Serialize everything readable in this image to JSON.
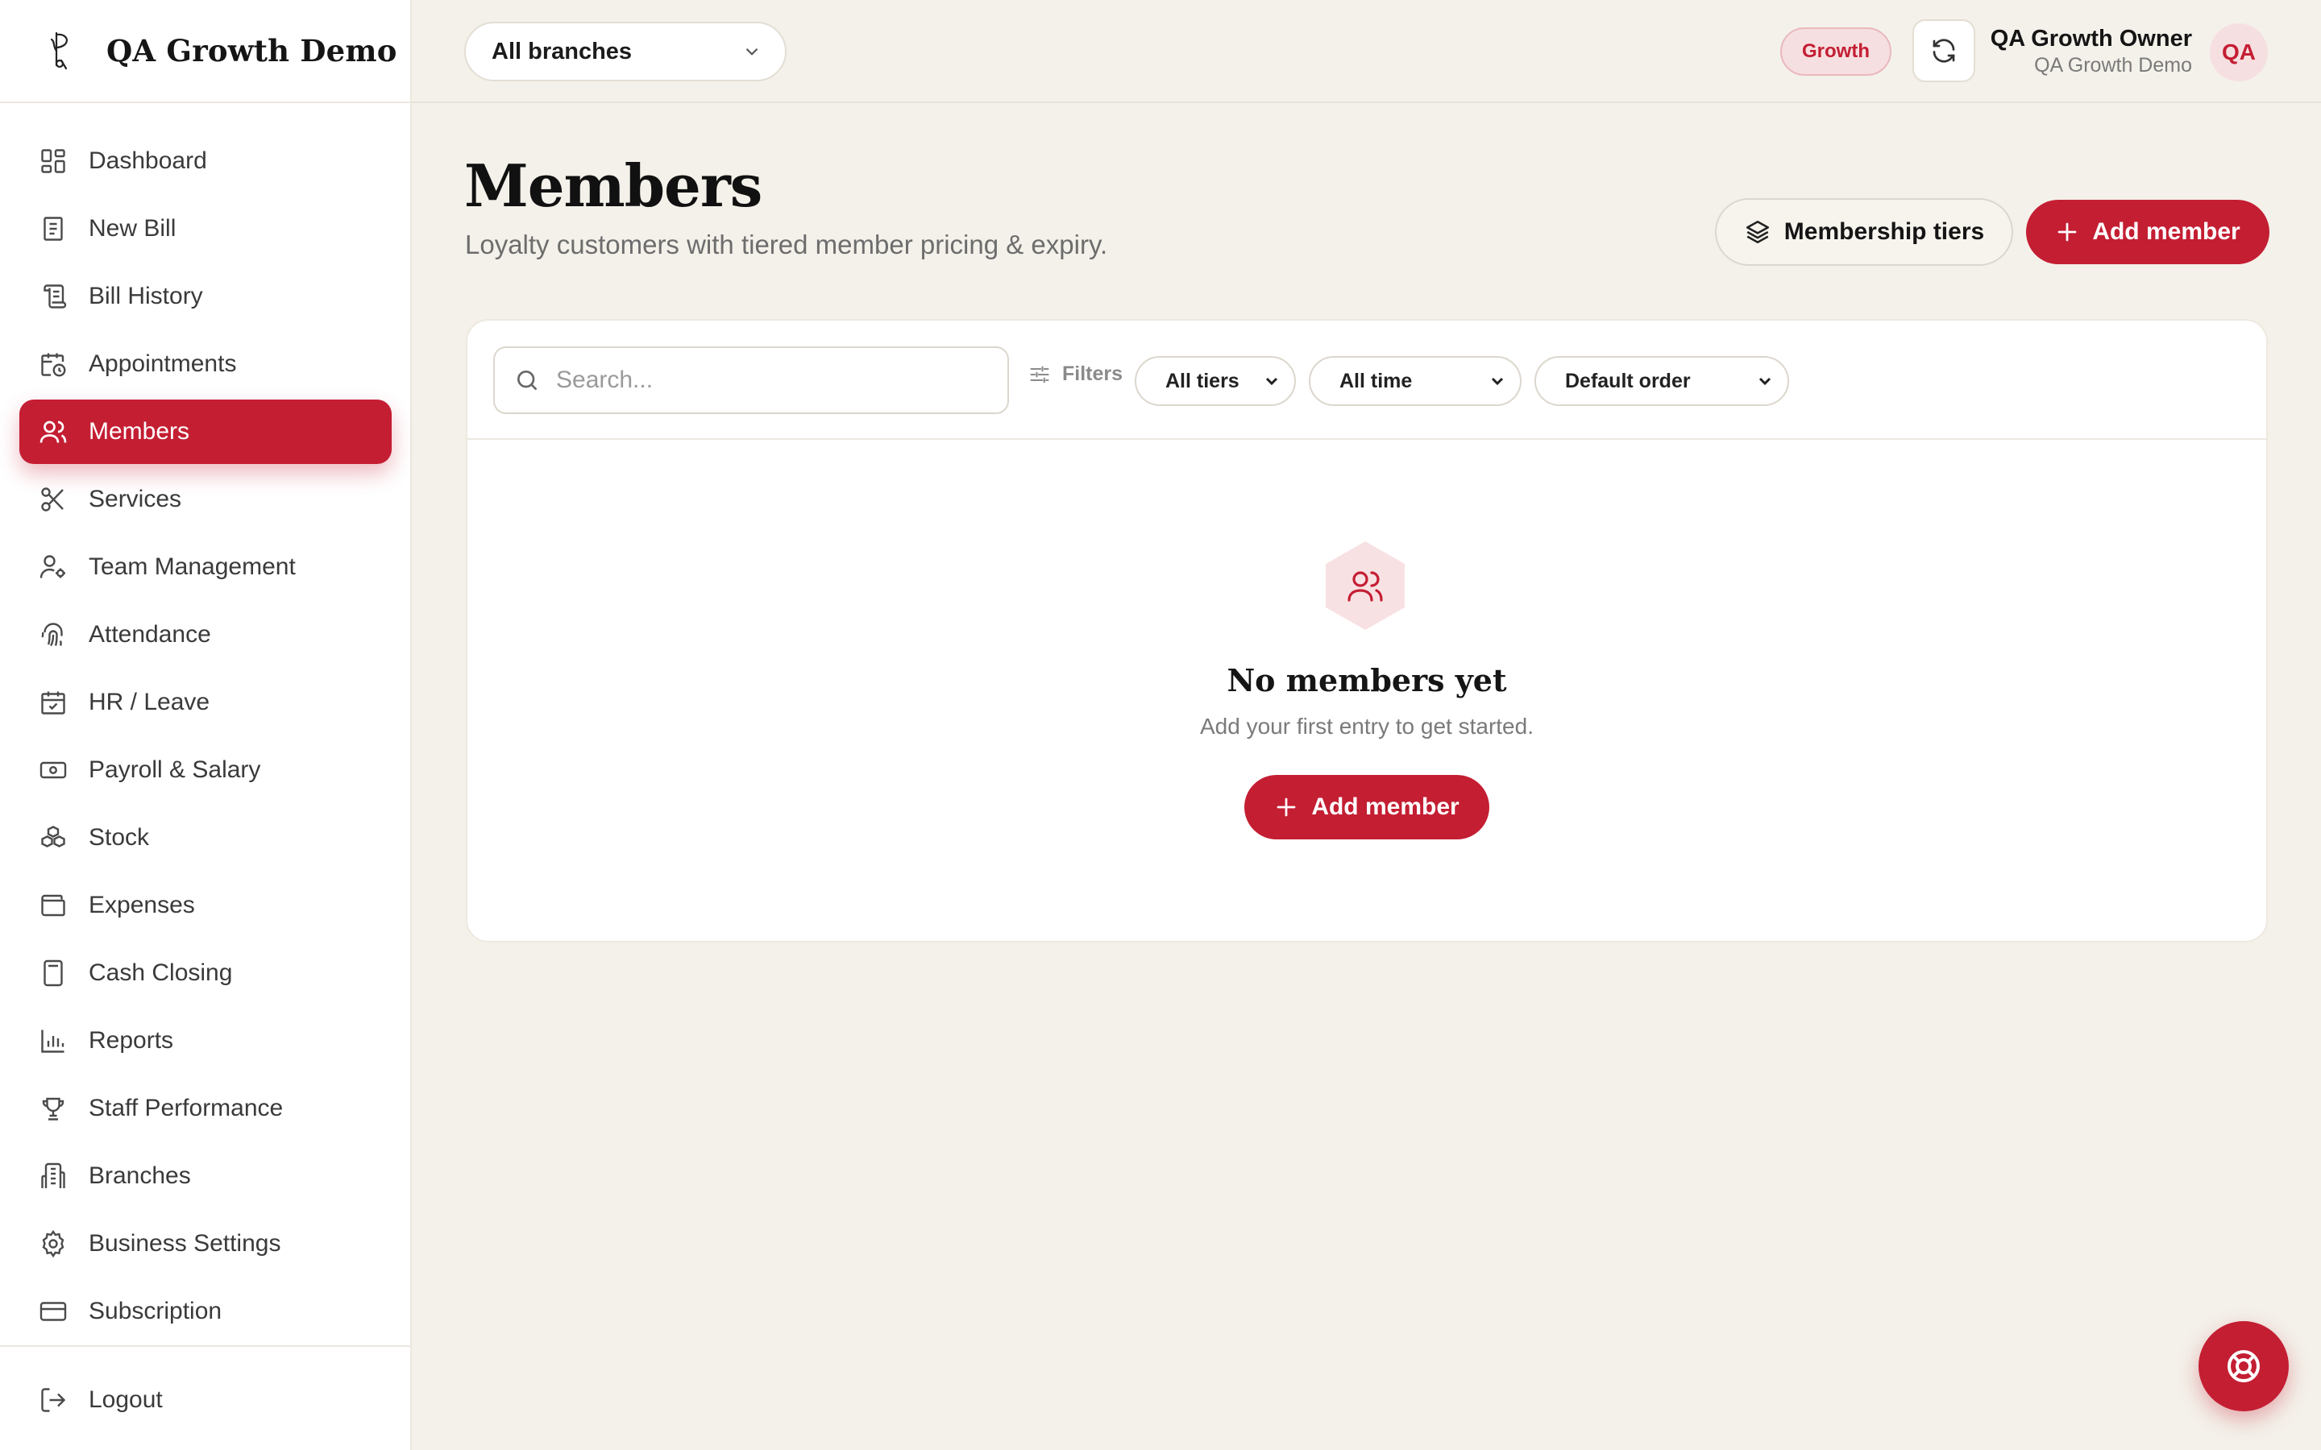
{
  "brand": {
    "name": "QA Growth Demo"
  },
  "sidebar": {
    "items": [
      {
        "label": "Dashboard",
        "icon": "dashboard-icon"
      },
      {
        "label": "New Bill",
        "icon": "receipt-icon"
      },
      {
        "label": "Bill History",
        "icon": "scroll-icon"
      },
      {
        "label": "Appointments",
        "icon": "calendar-clock-icon"
      },
      {
        "label": "Members",
        "icon": "users-icon",
        "active": true
      },
      {
        "label": "Services",
        "icon": "scissors-icon"
      },
      {
        "label": "Team Management",
        "icon": "user-cog-icon"
      },
      {
        "label": "Attendance",
        "icon": "fingerprint-icon"
      },
      {
        "label": "HR / Leave",
        "icon": "calendar-check-icon"
      },
      {
        "label": "Payroll & Salary",
        "icon": "banknote-icon"
      },
      {
        "label": "Stock",
        "icon": "boxes-icon"
      },
      {
        "label": "Expenses",
        "icon": "wallet-icon"
      },
      {
        "label": "Cash Closing",
        "icon": "calculator-icon"
      },
      {
        "label": "Reports",
        "icon": "bar-chart-icon"
      },
      {
        "label": "Staff Performance",
        "icon": "trophy-icon"
      },
      {
        "label": "Branches",
        "icon": "building-icon"
      },
      {
        "label": "Business Settings",
        "icon": "gear-icon"
      },
      {
        "label": "Subscription",
        "icon": "credit-card-icon"
      }
    ],
    "logout_label": "Logout"
  },
  "topbar": {
    "branch_select": "All branches",
    "plan_badge": "Growth",
    "user_name": "QA Growth Owner",
    "user_org": "QA Growth Demo",
    "avatar_initials": "QA"
  },
  "page": {
    "title": "Members",
    "subtitle": "Loyalty customers with tiered member pricing & expiry.",
    "tiers_button": "Membership tiers",
    "add_button": "Add member"
  },
  "filters": {
    "search_placeholder": "Search...",
    "filters_label": "Filters",
    "tier_select": "All tiers",
    "time_select": "All time",
    "order_select": "Default order"
  },
  "empty_state": {
    "title": "No members yet",
    "subtitle": "Add your first entry to get started.",
    "button": "Add member"
  },
  "colors": {
    "accent": "#c41e33",
    "background": "#f4f1ea",
    "sidebar": "#ffffff"
  }
}
